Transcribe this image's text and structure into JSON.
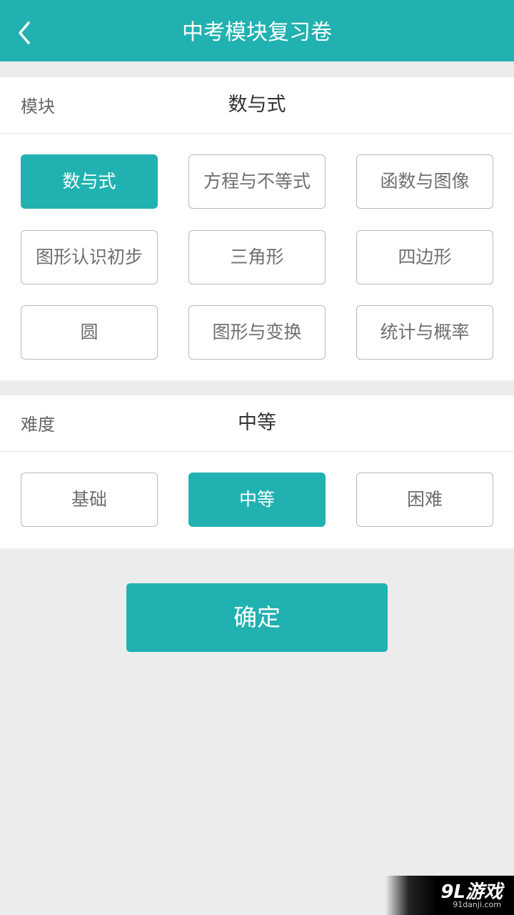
{
  "header": {
    "title": "中考模块复习卷"
  },
  "module": {
    "label": "模块",
    "selected_value": "数与式",
    "options": [
      {
        "label": "数与式",
        "selected": true
      },
      {
        "label": "方程与不等式",
        "selected": false
      },
      {
        "label": "函数与图像",
        "selected": false
      },
      {
        "label": "图形认识初步",
        "selected": false
      },
      {
        "label": "三角形",
        "selected": false
      },
      {
        "label": "四边形",
        "selected": false
      },
      {
        "label": "圆",
        "selected": false
      },
      {
        "label": "图形与变换",
        "selected": false
      },
      {
        "label": "统计与概率",
        "selected": false
      }
    ]
  },
  "difficulty": {
    "label": "难度",
    "selected_value": "中等",
    "options": [
      {
        "label": "基础",
        "selected": false
      },
      {
        "label": "中等",
        "selected": true
      },
      {
        "label": "困难",
        "selected": false
      }
    ]
  },
  "confirm": {
    "label": "确定"
  },
  "watermark": {
    "main": "9L游戏",
    "sub": "91danji.com"
  },
  "colors": {
    "accent": "#21b1b1",
    "background": "#ececec"
  },
  "icons": {
    "back": "chevron-left-icon"
  }
}
